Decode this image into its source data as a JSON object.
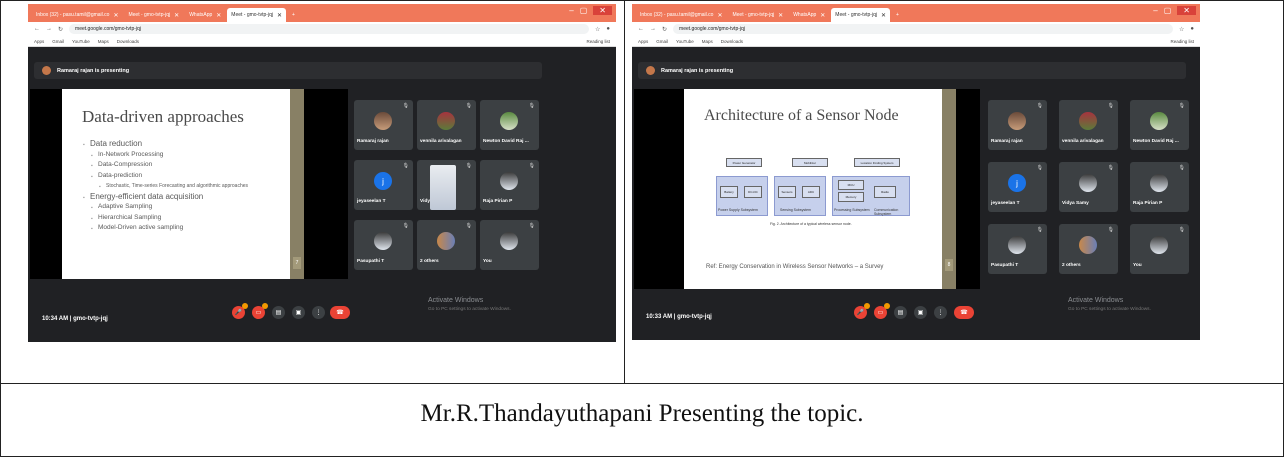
{
  "caption": "Mr.R.Thandayuthapani Presenting the topic.",
  "screenshots": [
    {
      "tabs": [
        "Inbox (32) - pasu.tamil@gmail.co",
        "Meet - gmo-tvtp-jqj",
        "WhatsApp",
        "Meet - gmo-tvtp-jqj"
      ],
      "url": "meet.google.com/gmo-tvtp-jqj",
      "bookmarks": [
        "Apps",
        "Gmail",
        "YouTube",
        "Maps",
        "Downloads"
      ],
      "reading_list": "Reading list",
      "presenter_text": "Ramaraj rajan is presenting",
      "slide": {
        "title": "Data-driven approaches",
        "bullets": [
          {
            "level": 1,
            "text": "Data reduction"
          },
          {
            "level": 2,
            "text": "In-Network Processing"
          },
          {
            "level": 2,
            "text": "Data-Compression"
          },
          {
            "level": 2,
            "text": "Data-prediction"
          },
          {
            "level": 3,
            "text": "Stochastic, Time-series Forecasting and algorithmic approaches"
          },
          {
            "level": 1,
            "text": "Energy-efficient data acquisition"
          },
          {
            "level": 2,
            "text": "Adaptive Sampling"
          },
          {
            "level": 2,
            "text": "Hierarchical Sampling"
          },
          {
            "level": 2,
            "text": "Model-Driven active sampling"
          }
        ],
        "page_number": "7"
      },
      "participants": [
        "Ramaraj rajan",
        "vennila arivalagan",
        "Newton David Raj ...",
        "jeyaseelan T",
        "Vidya Samy",
        "Raja Pirian P",
        "Pasupathi T",
        "2 others",
        "You"
      ],
      "meeting_info": "10:34 AM  |  gmo-tvtp-jqj",
      "activate_title": "Activate Windows",
      "activate_sub": "Go to PC settings to activate Windows."
    },
    {
      "tabs": [
        "Inbox (32) - pasu.tamil@gmail.co",
        "Meet - gmo-tvtp-jqj",
        "WhatsApp",
        "Meet - gmo-tvtp-jqj"
      ],
      "url": "meet.google.com/gmo-tvtp-jqj",
      "bookmarks": [
        "Apps",
        "Gmail",
        "YouTube",
        "Maps",
        "Downloads"
      ],
      "reading_list": "Reading list",
      "presenter_text": "Ramaraj rajan is presenting",
      "slide": {
        "title": "Architecture of a Sensor Node",
        "diagram_labels": [
          "Power Generator",
          "Mobilizer",
          "Location Finding System",
          "Battery",
          "DC-DC",
          "Sensors",
          "ADC",
          "MCU",
          "Memory",
          "Radio",
          "Power Supply Subsystem",
          "Sensing Subsystem",
          "Processing Subsystem",
          "Communication Subsystem"
        ],
        "figure_caption": "Fig. 2. Architecture of a typical wireless sensor node.",
        "reference": "Ref: Energy Conservation in Wireless Sensor Networks – a Survey",
        "page_number": "8"
      },
      "participants": [
        "Ramaraj rajan",
        "vennila arivalagan",
        "Newton David Raj ...",
        "jeyaseelan T",
        "Vidya Samy",
        "Raja Pirian P",
        "Pasupathi T",
        "2 others",
        "You"
      ],
      "meeting_info": "10:33 AM  |  gmo-tvtp-jqj",
      "activate_title": "Activate Windows",
      "activate_sub": "Go to PC settings to activate Windows."
    }
  ],
  "icons": {
    "back": "back-icon",
    "forward": "forward-icon",
    "reload": "reload-icon",
    "mic_off": "mic-off-icon",
    "cam_off": "camera-off-icon",
    "captions": "captions-icon",
    "present": "present-icon",
    "more": "more-icon",
    "end_call": "end-call-icon"
  },
  "colors": {
    "tab_strip": "#f0785a",
    "meet_bg": "#202124",
    "tile": "#3c4043",
    "end_call": "#ea4335"
  }
}
